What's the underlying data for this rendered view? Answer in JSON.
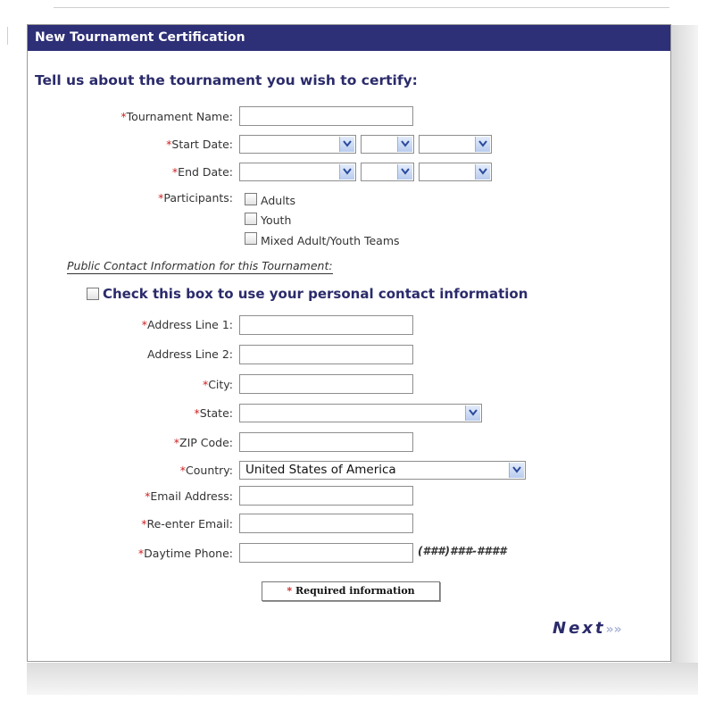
{
  "form": {
    "title": "New Tournament Certification",
    "heading": "Tell us about the tournament you wish to certify:",
    "required_mark": "*",
    "labels": {
      "tournament_name": "Tournament Name:",
      "start_date": "Start Date:",
      "end_date": "End Date:",
      "participants": "Participants:",
      "address1": "Address Line 1:",
      "address2": "Address Line 2:",
      "city": "City:",
      "state": "State:",
      "zip": "ZIP Code:",
      "country": "Country:",
      "email": "Email Address:",
      "reenter_email": "Re-enter Email:",
      "phone": "Daytime Phone:"
    },
    "participants": [
      "Adults",
      "Youth",
      "Mixed Adult/Youth Teams"
    ],
    "public_contact_heading": "Public Contact Information for this Tournament:",
    "personal_contact_checkbox": "Check this box to use your personal contact information",
    "country_value": "United States of America",
    "phone_hint": "(###)###-####",
    "required_info": "Required information",
    "next_label": "Next",
    "next_arrows": "»»"
  },
  "colors": {
    "titlebar": "#2d2f77",
    "heading": "#2b2b6b",
    "required": "#cc2222"
  }
}
